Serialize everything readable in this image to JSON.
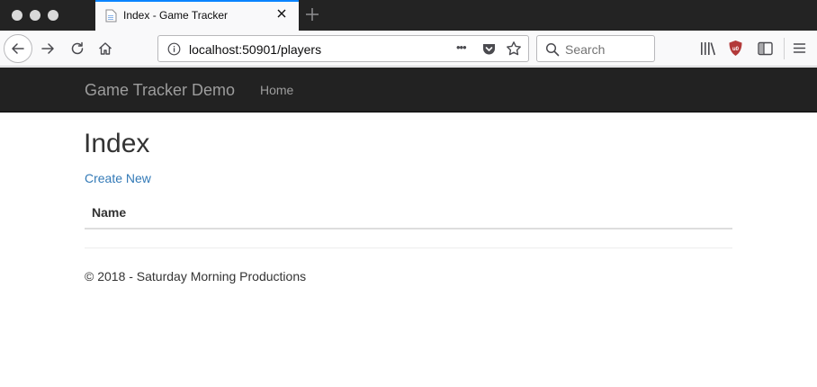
{
  "browser": {
    "tab_title": "Index - Game Tracker",
    "url": "localhost:50901/players",
    "search_placeholder": "Search",
    "page_actions_label": "•••"
  },
  "app": {
    "brand": "Game Tracker Demo",
    "nav": [
      "Home"
    ],
    "page_title": "Index",
    "create_link": "Create New",
    "table": {
      "columns": [
        "Name"
      ],
      "rows": []
    },
    "footer": "© 2018 - Saturday Morning Productions"
  },
  "colors": {
    "tab_accent": "#0a84ff",
    "app_navbar": "#222222",
    "link": "#337ab7"
  },
  "icons": [
    "back-arrow-icon",
    "forward-arrow-icon",
    "reload-icon",
    "home-icon",
    "info-icon",
    "pocket-icon",
    "star-icon",
    "search-icon",
    "library-icon",
    "ublock-icon",
    "sidebar-icon",
    "menu-icon",
    "close-icon",
    "plus-icon",
    "page-favicon-icon"
  ]
}
